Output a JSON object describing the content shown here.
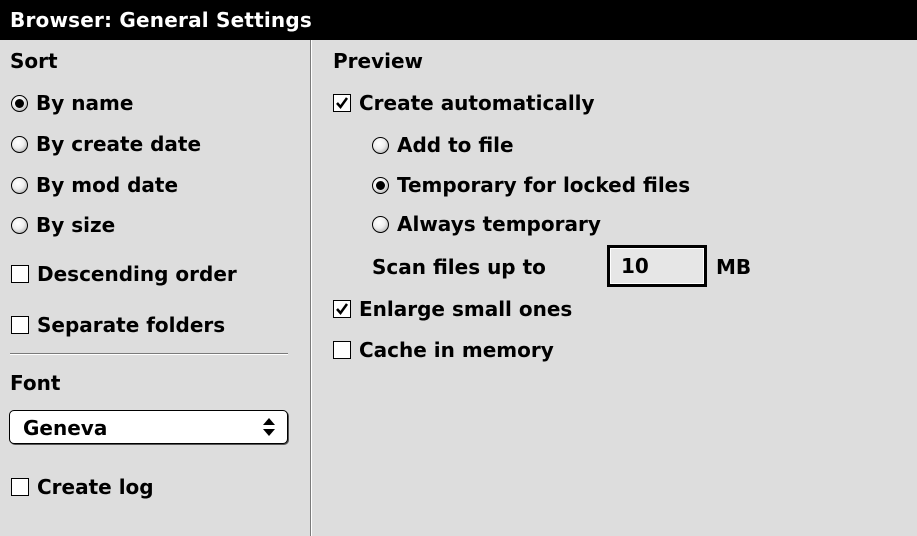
{
  "window": {
    "title": "Browser: General Settings"
  },
  "sort": {
    "title": "Sort",
    "options": [
      {
        "label": "By name",
        "selected": true
      },
      {
        "label": "By create date",
        "selected": false
      },
      {
        "label": "By mod date",
        "selected": false
      },
      {
        "label": "By size",
        "selected": false
      }
    ],
    "descending_order": {
      "label": "Descending order",
      "checked": false
    },
    "separate_folders": {
      "label": "Separate folders",
      "checked": false
    }
  },
  "font": {
    "title": "Font",
    "selected": "Geneva"
  },
  "create_log": {
    "label": "Create log",
    "checked": false
  },
  "preview": {
    "title": "Preview",
    "create_automatically": {
      "label": "Create automatically",
      "checked": true
    },
    "options": [
      {
        "label": "Add to file",
        "selected": false
      },
      {
        "label": "Temporary for locked files",
        "selected": true
      },
      {
        "label": "Always temporary",
        "selected": false
      }
    ],
    "scan": {
      "label": "Scan files up to",
      "value": "10",
      "unit": "MB"
    },
    "enlarge_small": {
      "label": "Enlarge small ones",
      "checked": true
    },
    "cache_in_memory": {
      "label": "Cache in memory",
      "checked": false
    }
  }
}
